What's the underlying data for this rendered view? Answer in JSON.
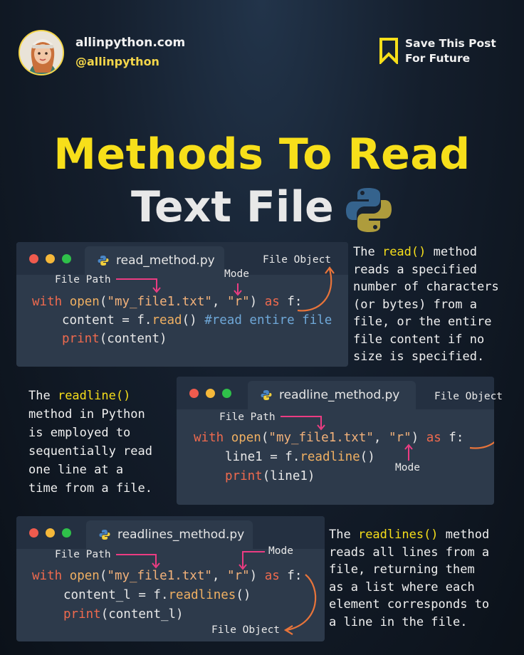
{
  "header": {
    "site": "allinpython.com",
    "handle": "@allinpython",
    "save_line1": "Save This Post",
    "save_line2": "For Future"
  },
  "title": {
    "line1": "Methods To Read",
    "line2": "Text File"
  },
  "colors": {
    "accent_yellow": "#f7df1a",
    "card_bg": "#2d3a4b",
    "arrow_pink": "#ec3c82",
    "arrow_orange": "#e8743a"
  },
  "icons": {
    "python_logo": "python-logo-icon",
    "save": "bookmark-icon"
  },
  "cards": [
    {
      "filename": "read_method.py",
      "ann_file_path": "File Path",
      "ann_mode": "Mode",
      "ann_file_object": "File Object",
      "code": {
        "l1_kw": "with",
        "l1_fn": "open",
        "l1_p1": "(",
        "l1_str1": "\"my_file1.txt\"",
        "l1_comma": ", ",
        "l1_str2": "\"r\"",
        "l1_p2": ") ",
        "l1_as": "as",
        "l1_var": " f:",
        "l2_pre": "content = f.",
        "l2_fn": "read",
        "l2_post": "() ",
        "l2_comment": "#read entire file",
        "l3_fn": "print",
        "l3_post": "(content)"
      },
      "desc": {
        "p1": "The ",
        "hl": "read()",
        "p2": " method",
        "rest": "reads a specified\nnumber of characters\n(or bytes) from a\nfile, or the entire\nfile content if no\nsize is specified."
      }
    },
    {
      "filename": "readline_method.py",
      "ann_file_path": "File Path",
      "ann_mode": "Mode",
      "ann_file_object": "File Object",
      "code": {
        "l1_kw": "with",
        "l1_fn": "open",
        "l1_p1": "(",
        "l1_str1": "\"my_file1.txt\"",
        "l1_comma": ", ",
        "l1_str2": "\"r\"",
        "l1_p2": ") ",
        "l1_as": "as",
        "l1_var": " f:",
        "l2_pre": "line1 = f.",
        "l2_fn": "readline",
        "l2_post": "()",
        "l3_fn": "print",
        "l3_post": "(line1)"
      },
      "desc": {
        "p1": "The ",
        "hl": "readline()",
        "p2": "",
        "rest": "method in Python\nis employed to\nsequentially read\none line at a\ntime from a file."
      }
    },
    {
      "filename": "readlines_method.py",
      "ann_file_path": "File Path",
      "ann_mode": "Mode",
      "ann_file_object": "File Object",
      "code": {
        "l1_kw": "with",
        "l1_fn": "open",
        "l1_p1": "(",
        "l1_str1": "\"my_file1.txt\"",
        "l1_comma": ", ",
        "l1_str2": "\"r\"",
        "l1_p2": ") ",
        "l1_as": "as",
        "l1_var": " f:",
        "l2_pre": "content_l = f.",
        "l2_fn": "readlines",
        "l2_post": "()",
        "l3_fn": "print",
        "l3_post": "(content_l)"
      },
      "desc": {
        "p1": "The ",
        "hl": "readlines()",
        "p2": " method",
        "rest": "reads all lines from a\nfile, returning them\nas a list where each\nelement corresponds to\na line in the file."
      }
    }
  ]
}
